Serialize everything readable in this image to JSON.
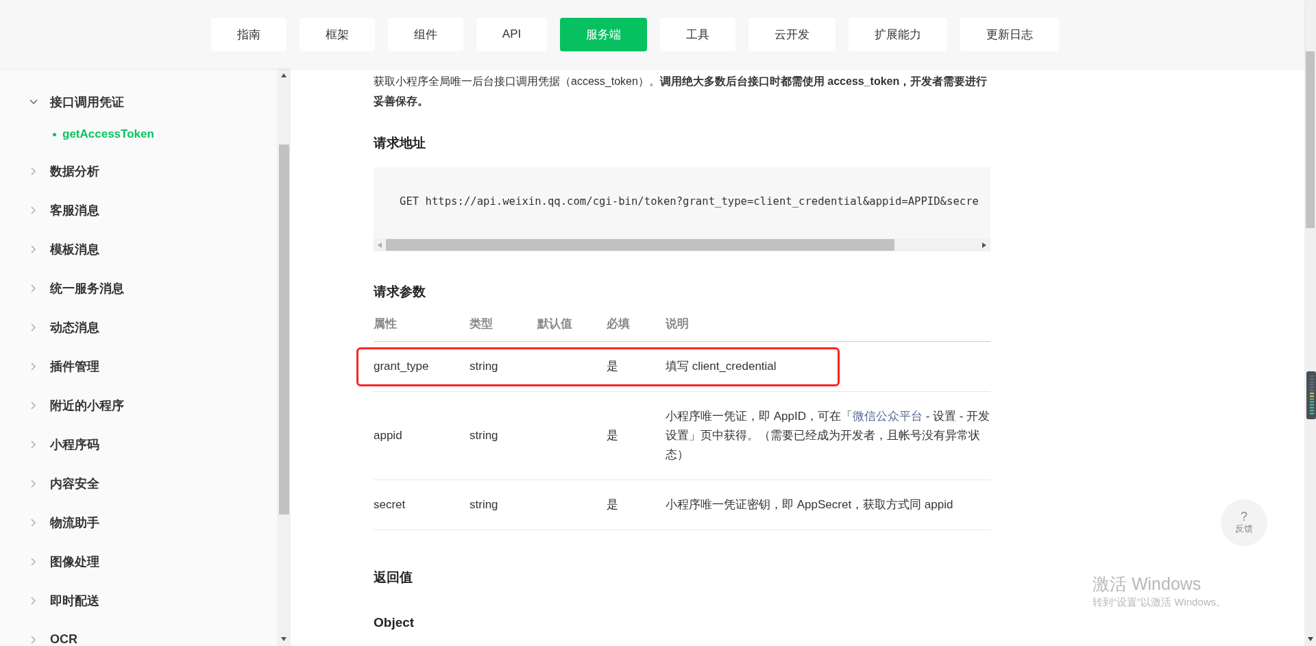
{
  "nav": [
    {
      "label": "指南",
      "selected": false
    },
    {
      "label": "框架",
      "selected": false
    },
    {
      "label": "组件",
      "selected": false
    },
    {
      "label": "API",
      "selected": false
    },
    {
      "label": "服务端",
      "selected": true
    },
    {
      "label": "工具",
      "selected": false
    },
    {
      "label": "云开发",
      "selected": false
    },
    {
      "label": "扩展能力",
      "selected": false
    },
    {
      "label": "更新日志",
      "selected": false
    }
  ],
  "sidebar": {
    "items": [
      {
        "label": "接口调用凭证",
        "selected": false,
        "expanded": true,
        "children": [
          {
            "label": "getAccessToken",
            "selected": true
          }
        ]
      },
      {
        "label": "数据分析",
        "selected": false,
        "expanded": false
      },
      {
        "label": "客服消息",
        "selected": false,
        "expanded": false
      },
      {
        "label": "模板消息",
        "selected": false,
        "expanded": false
      },
      {
        "label": "统一服务消息",
        "selected": false,
        "expanded": false
      },
      {
        "label": "动态消息",
        "selected": false,
        "expanded": false
      },
      {
        "label": "插件管理",
        "selected": false,
        "expanded": false
      },
      {
        "label": "附近的小程序",
        "selected": false,
        "expanded": false
      },
      {
        "label": "小程序码",
        "selected": false,
        "expanded": false
      },
      {
        "label": "内容安全",
        "selected": false,
        "expanded": false
      },
      {
        "label": "物流助手",
        "selected": false,
        "expanded": false
      },
      {
        "label": "图像处理",
        "selected": false,
        "expanded": false
      },
      {
        "label": "即时配送",
        "selected": false,
        "expanded": false
      },
      {
        "label": "OCR",
        "selected": false,
        "expanded": false
      }
    ]
  },
  "intro": {
    "text": "获取小程序全局唯一后台接口调用凭据（access_token）。**调用绝大多数后台接口时都需使用 access_token，开发者需要进行妥善保存。**"
  },
  "request_url": {
    "heading": "请求地址",
    "code": "GET https://api.weixin.qq.com/cgi-bin/token?grant_type=client_credential&appid=APPID&secre"
  },
  "request_params": {
    "heading": "请求参数",
    "columns": [
      "属性",
      "类型",
      "默认值",
      "必填",
      "说明"
    ],
    "rows": [
      {
        "name": "grant_type",
        "type": "string",
        "required": "是",
        "highlighted": true,
        "description": [
          {
            "kind": "text",
            "text": "填写 client_credential"
          }
        ]
      },
      {
        "name": "appid",
        "type": "string",
        "required": "是",
        "highlighted": false,
        "description": [
          {
            "kind": "text",
            "text": "小程序唯一凭证，即 AppID，可在「"
          },
          {
            "kind": "link",
            "text": "微信公众平台"
          },
          {
            "kind": "text",
            "text": " - 设置 - 开发设置」页中获得。（需要已经成为开发者，且帐号没有异常状态）"
          }
        ]
      },
      {
        "name": "secret",
        "type": "string",
        "required": "是",
        "highlighted": false,
        "description": [
          {
            "kind": "text",
            "text": "小程序唯一凭证密钥，即 AppSecret，获取方式同 appid"
          }
        ]
      }
    ]
  },
  "return_value": {
    "heading": "返回值"
  },
  "object_heading": "Object",
  "feedback": {
    "icon": "?",
    "label": "反馈"
  },
  "os_notice": {
    "title": "激活 Windows",
    "subtitle": "转到“设置”以激活 Windows。"
  }
}
